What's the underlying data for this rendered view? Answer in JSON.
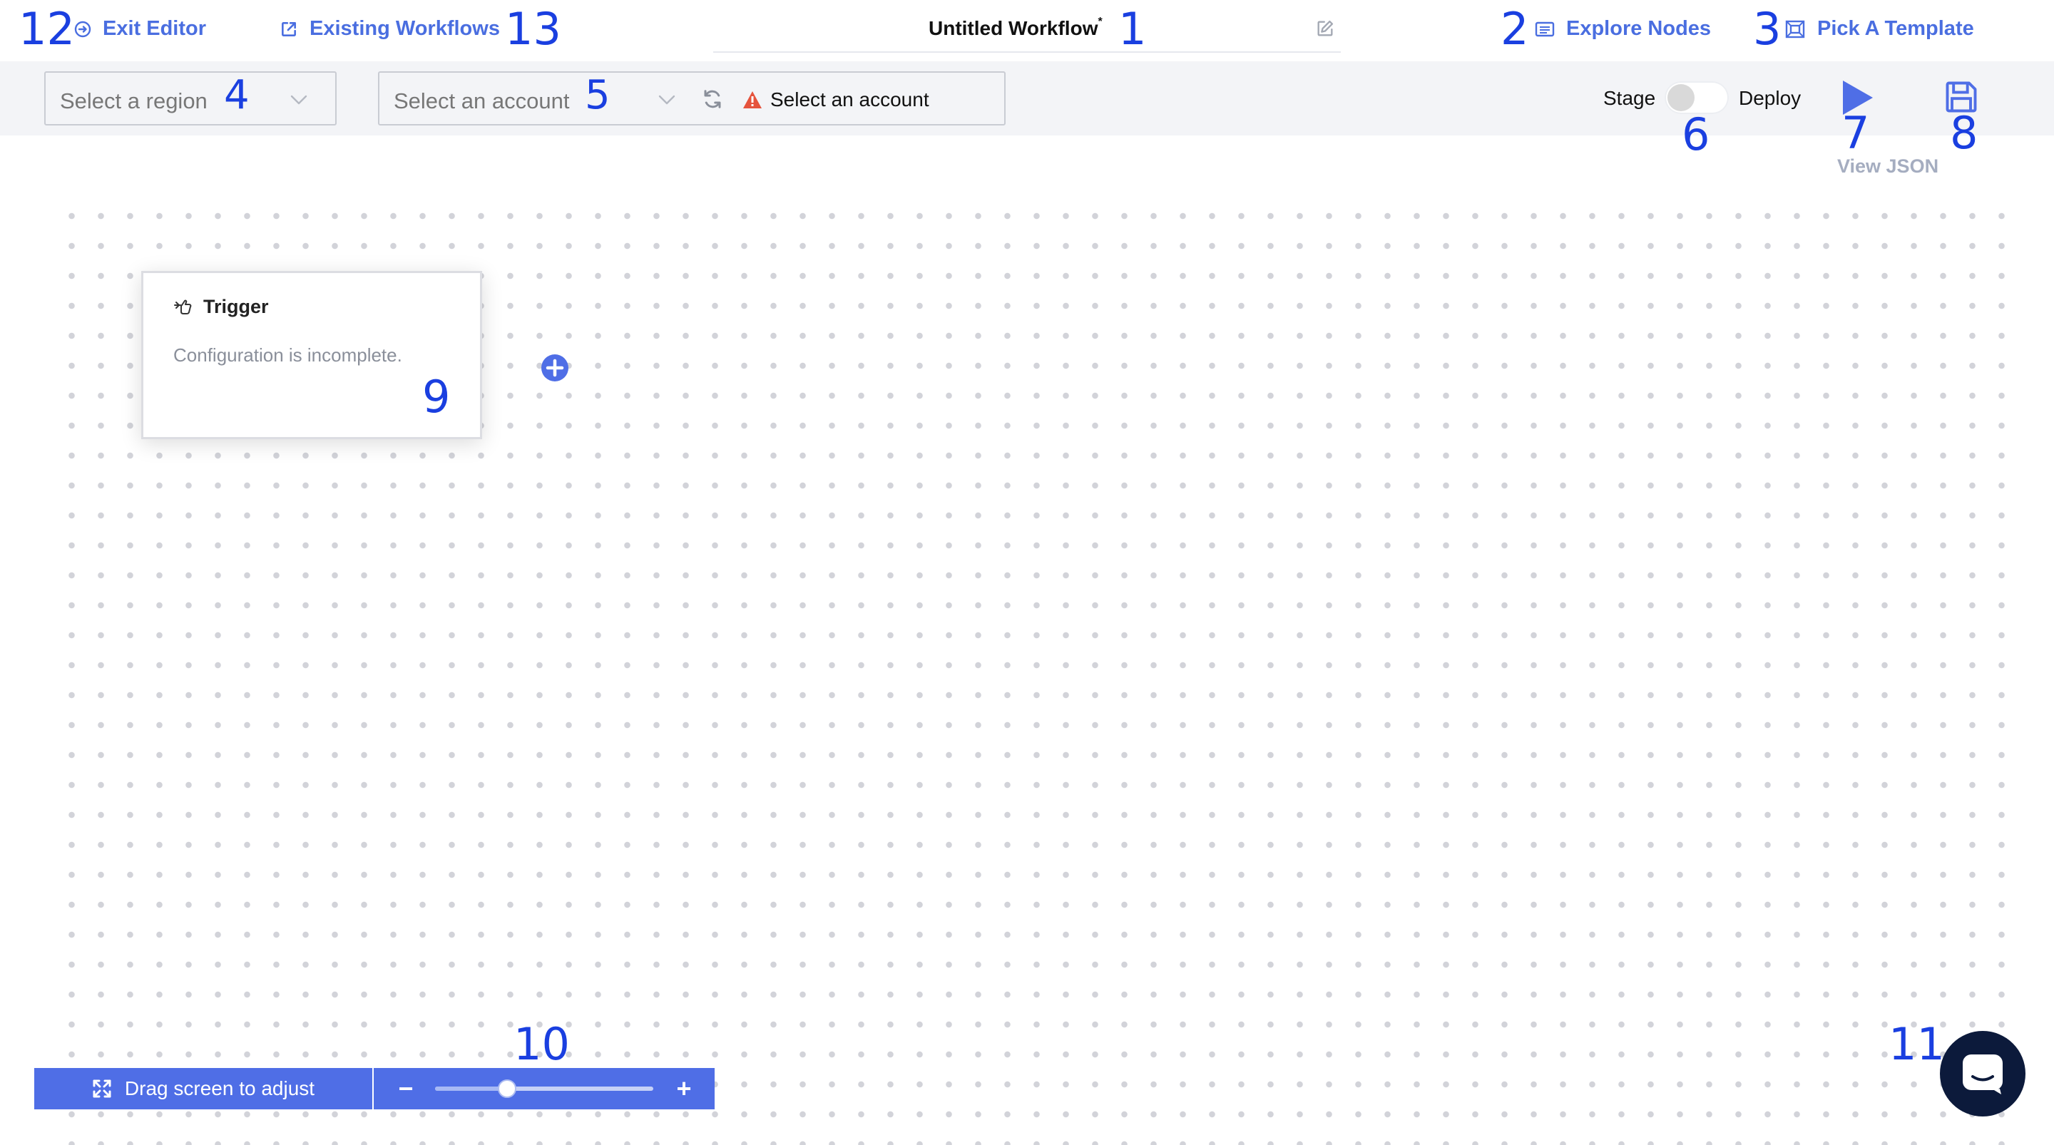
{
  "header": {
    "exit_editor": "Exit Editor",
    "existing_workflows": "Existing Workflows",
    "workflow_title": "Untitled Workflow",
    "unsaved_mark": "*",
    "explore_nodes": "Explore Nodes",
    "pick_template": "Pick A Template"
  },
  "toolbar": {
    "region_placeholder": "Select a region",
    "account_placeholder": "Select an account",
    "account_warning": "Select an account",
    "stage_label": "Stage",
    "deploy_label": "Deploy",
    "toggle_on": false,
    "view_json": "View JSON"
  },
  "canvas": {
    "node": {
      "title": "Trigger",
      "message": "Configuration is incomplete."
    }
  },
  "bottom": {
    "drag_label": "Drag screen to adjust",
    "zoom_minus": "−",
    "zoom_plus": "+",
    "zoom_level": 0.33
  },
  "markers": {
    "m1": "1",
    "m2": "2",
    "m3": "3",
    "m4": "4",
    "m5": "5",
    "m6": "6",
    "m7": "7",
    "m8": "8",
    "m9": "9",
    "m10": "10",
    "m11": "11",
    "m12": "12",
    "m13": "13"
  },
  "colors": {
    "accent": "#4f6ee6",
    "link": "#4a6ee0",
    "marker": "#1a3fe0",
    "warning": "#e5533d",
    "chat": "#0c1a3b"
  },
  "icons": {
    "exit": "circle-arrow-right-icon",
    "external": "external-link-icon",
    "edit": "pencil-square-icon",
    "explore": "list-panel-icon",
    "template": "template-frame-icon",
    "refresh": "refresh-icon",
    "warning": "warning-triangle-icon",
    "play": "play-icon",
    "save": "floppy-disk-icon",
    "trigger": "pointing-hand-icon",
    "add": "plus-circle-icon",
    "expand": "expand-arrows-icon",
    "chat": "chat-bubble-icon"
  }
}
